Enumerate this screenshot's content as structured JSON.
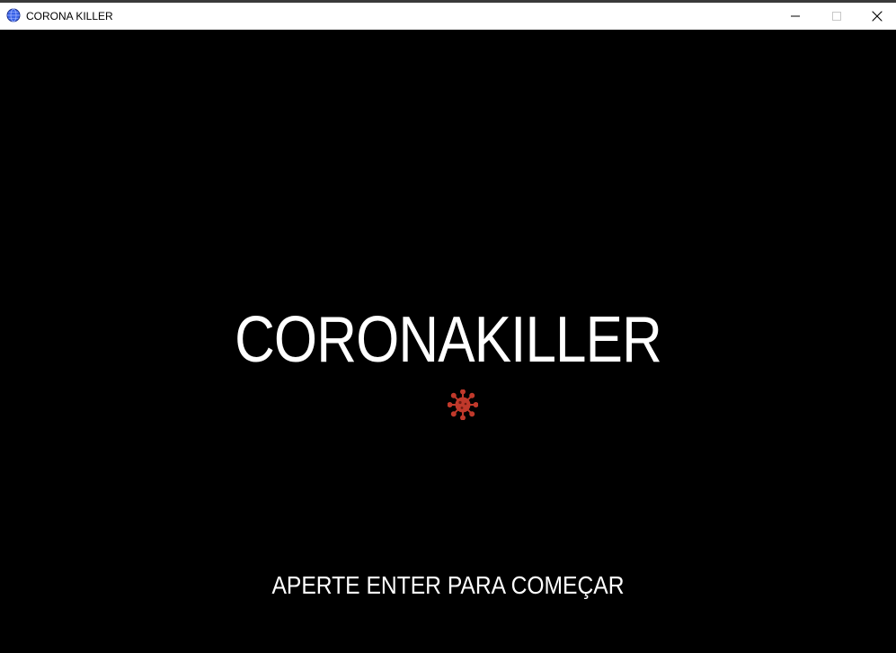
{
  "window": {
    "title": "CORONA KILLER",
    "icon": "globe-icon",
    "controls": [
      "minimize-icon",
      "maximize-icon",
      "close-icon"
    ]
  },
  "game": {
    "title": "CORONAKILLER",
    "sprite": "virus-icon",
    "prompt": "APERTE ENTER PARA COMEÇAR"
  },
  "colors": {
    "background": "#000000",
    "text": "#ffffff",
    "virus": "#c0392b",
    "titlebar": "#ffffff"
  }
}
